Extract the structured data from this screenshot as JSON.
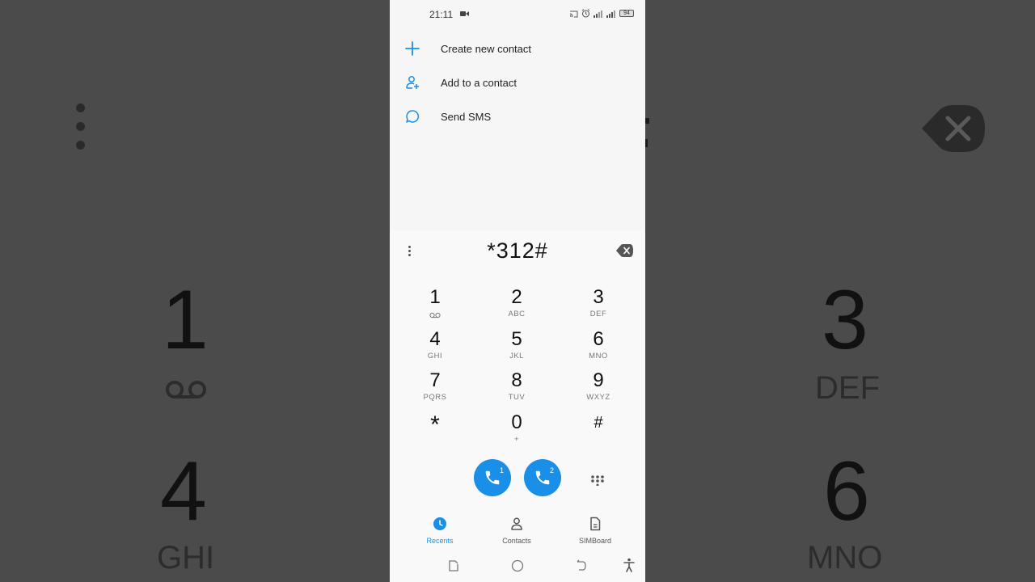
{
  "status_bar": {
    "time": "21:11",
    "battery": "94"
  },
  "menu": [
    {
      "icon": "plus-icon",
      "label": "Create new contact"
    },
    {
      "icon": "add-person-icon",
      "label": "Add to a contact"
    },
    {
      "icon": "message-icon",
      "label": "Send SMS"
    }
  ],
  "dialer": {
    "number": "*312#",
    "keys": [
      {
        "digit": "1",
        "letters": ""
      },
      {
        "digit": "2",
        "letters": "ABC"
      },
      {
        "digit": "3",
        "letters": "DEF"
      },
      {
        "digit": "4",
        "letters": "GHI"
      },
      {
        "digit": "5",
        "letters": "JKL"
      },
      {
        "digit": "6",
        "letters": "MNO"
      },
      {
        "digit": "7",
        "letters": "PQRS"
      },
      {
        "digit": "8",
        "letters": "TUV"
      },
      {
        "digit": "9",
        "letters": "WXYZ"
      },
      {
        "digit": "*",
        "letters": ""
      },
      {
        "digit": "0",
        "letters": "+"
      },
      {
        "digit": "#",
        "letters": ""
      }
    ],
    "call_buttons": [
      {
        "sim": "1"
      },
      {
        "sim": "2"
      }
    ]
  },
  "tabs": [
    {
      "label": "Recents",
      "active": true
    },
    {
      "label": "Contacts",
      "active": false
    },
    {
      "label": "SIMBoard",
      "active": false
    }
  ],
  "background": {
    "digits": [
      "1",
      "3",
      "4",
      "6"
    ],
    "letters": [
      "DEF",
      "GHI",
      "MNO"
    ]
  },
  "colors": {
    "accent": "#1a8fe8",
    "phone_bg": "#f6f6f6",
    "backdrop": "#4b4b4b"
  }
}
